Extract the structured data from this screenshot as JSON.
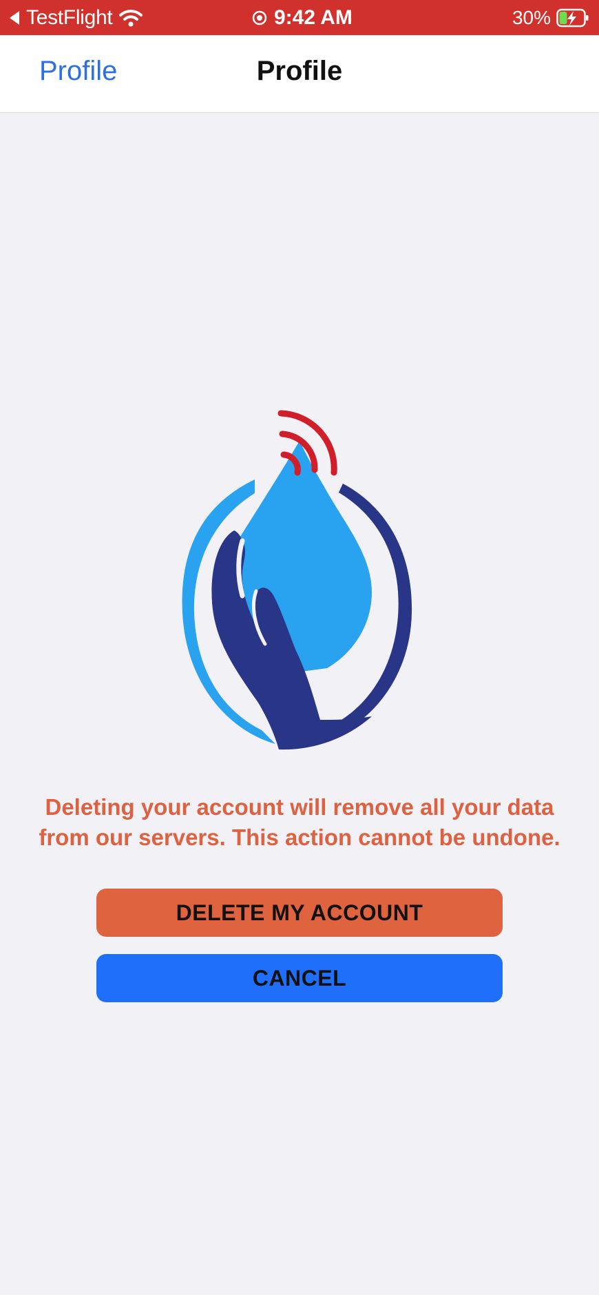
{
  "status_bar": {
    "carrier": "TestFlight",
    "time": "9:42 AM",
    "battery_percent": "30%",
    "back_icon": "back-arrow-icon",
    "wifi_icon": "wifi-icon",
    "location_icon": "location-lock-icon",
    "battery_icon": "battery-charging-icon",
    "background_color": "#d0312c"
  },
  "nav": {
    "back_label": "Profile",
    "title": "Profile",
    "back_color": "#2f6fdd"
  },
  "logo": {
    "icon": "water-drop-hand-signal-logo",
    "colors": {
      "light_blue": "#29a3ef",
      "dark_blue": "#293587",
      "red": "#d01f2b"
    }
  },
  "main": {
    "warning_text": "Deleting your account will remove all your data from our servers. This action cannot be undone.",
    "warning_color": "#dc6242",
    "delete_button_label": "DELETE MY ACCOUNT",
    "delete_button_color": "#e0633f",
    "cancel_button_label": "CANCEL",
    "cancel_button_color": "#1f6ffb"
  }
}
